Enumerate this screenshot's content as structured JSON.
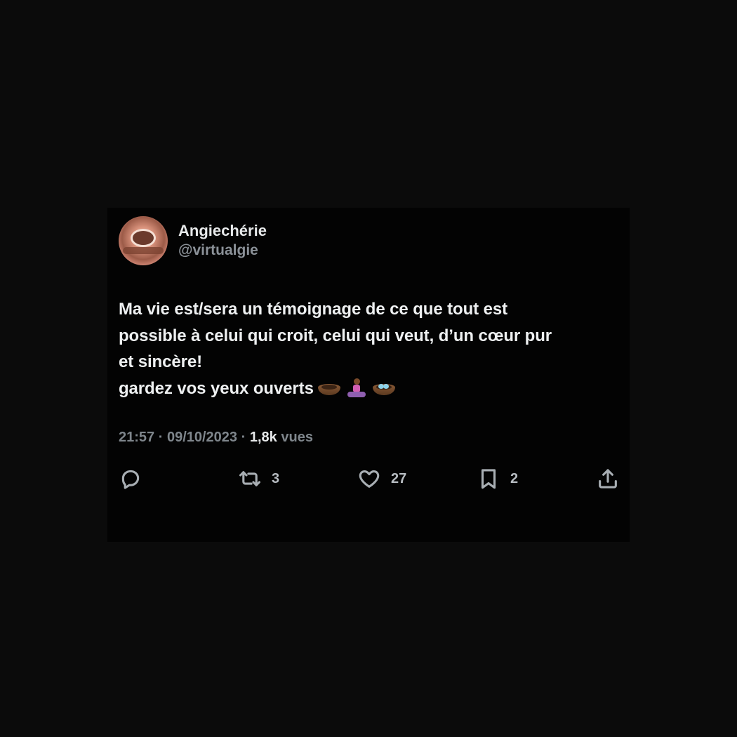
{
  "tweet": {
    "display_name": "Angiechérie",
    "handle": "@virtualgie",
    "text_lines": [
      "Ma vie est/sera un témoignage de ce que tout est",
      "possible à celui qui croit, celui qui veut, d’un cœur pur",
      "et sincère!",
      "gardez vos yeux ouverts"
    ],
    "emojis": [
      "nest-with-eggs-icon",
      "person-in-lotus-position-icon",
      "nest-with-eggs-icon"
    ],
    "time": "21:57",
    "date": "09/10/2023",
    "views_count": "1,8k",
    "views_label": "vues",
    "separator": "·"
  },
  "actions": {
    "reply_count": "",
    "retweet_count": "3",
    "like_count": "27",
    "bookmark_count": "2"
  },
  "colors": {
    "background": "#0b0b0b",
    "card": "#030303",
    "text": "#e7e9ea",
    "muted": "#7f868c"
  }
}
